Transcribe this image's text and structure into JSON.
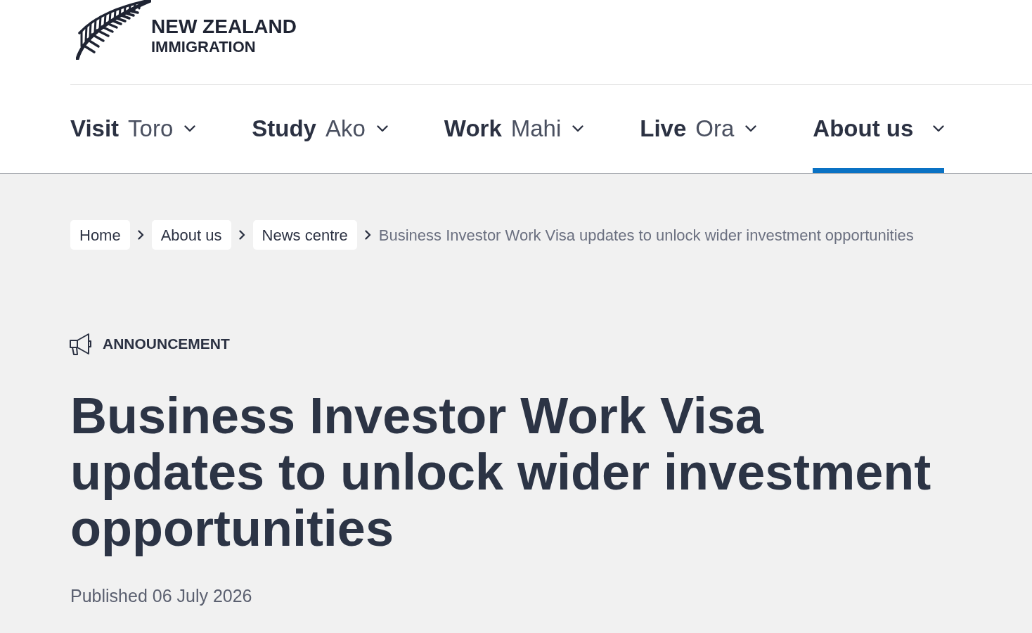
{
  "logo": {
    "line_1": "NEW ZEALAND",
    "line_2": "IMMIGRATION"
  },
  "nav": {
    "items": [
      {
        "label": "Visit",
        "label_maori": "Toro",
        "selected": false
      },
      {
        "label": "Study",
        "label_maori": "Ako",
        "selected": false
      },
      {
        "label": "Work",
        "label_maori": "Mahi",
        "selected": false
      },
      {
        "label": "Live",
        "label_maori": "Ora",
        "selected": false
      },
      {
        "label": "About us",
        "selected": true
      }
    ]
  },
  "breadcrumb": {
    "links": [
      "Home",
      "About us",
      "News centre"
    ],
    "current": "Business Investor Work Visa updates to unlock wider investment opportunities"
  },
  "article": {
    "tag": "ANNOUNCEMENT",
    "title": "Business Investor Work Visa updates to unlock wider investment opportunities",
    "published": "Published 06 July 2026"
  }
}
